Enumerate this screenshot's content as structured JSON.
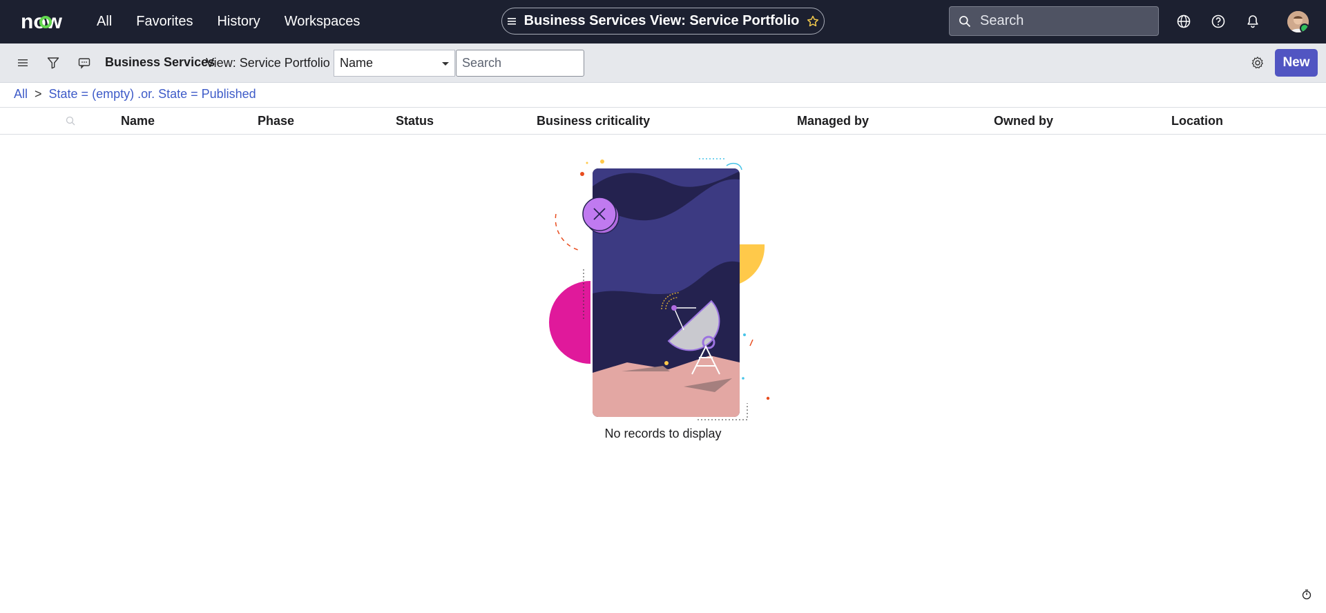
{
  "app": {
    "logo_text": "now",
    "nav": [
      "All",
      "Favorites",
      "History",
      "Workspaces"
    ],
    "page_title": "Business Services View: Service Portfolio",
    "search_placeholder": "Search"
  },
  "toolbar": {
    "list_title": "Business Services",
    "view_label": "View: Service Portfolio",
    "field_selected": "Name",
    "search_placeholder": "Search",
    "new_label": "New"
  },
  "breadcrumb": {
    "root": "All",
    "separator": ">",
    "filter": "State = (empty) .or. State = Published"
  },
  "table": {
    "columns": [
      "Name",
      "Phase",
      "Status",
      "Business criticality",
      "Managed by",
      "Owned by",
      "Location"
    ]
  },
  "empty_state": {
    "message": "No records to display"
  },
  "colors": {
    "topbar": "#1c2030",
    "accent": "#5155c2",
    "link": "#3e5bc8",
    "toolbar": "#e6e8ec"
  }
}
